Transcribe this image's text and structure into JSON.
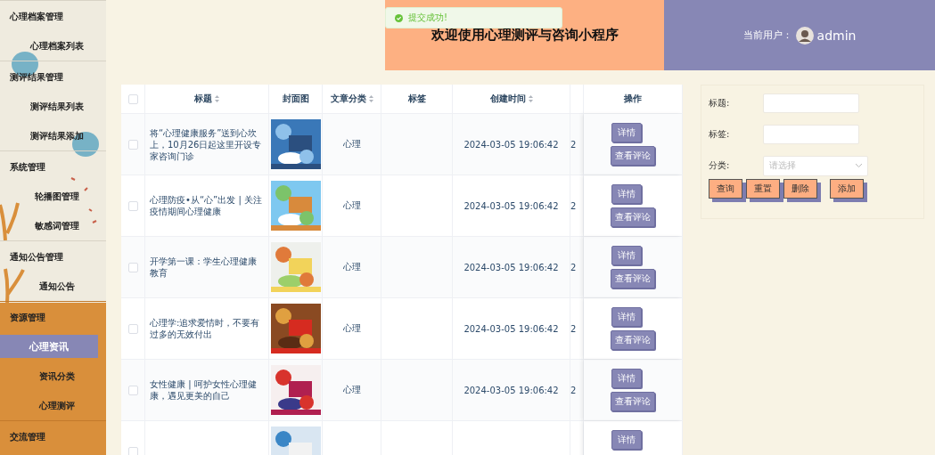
{
  "sidebar": {
    "groups": [
      {
        "label": "心理档案管理",
        "items": [
          {
            "label": "心理档案列表",
            "selected": false
          }
        ]
      },
      {
        "label": "测评结果管理",
        "items": [
          {
            "label": "测评结果列表",
            "selected": false
          },
          {
            "label": "测评结果添加",
            "selected": false
          }
        ]
      },
      {
        "label": "系统管理",
        "items": [
          {
            "label": "轮播图管理",
            "selected": false
          },
          {
            "label": "敏感词管理",
            "selected": false
          }
        ]
      },
      {
        "label": "通知公告管理",
        "items": [
          {
            "label": "通知公告",
            "selected": false
          }
        ]
      },
      {
        "label": "资源管理",
        "items": [
          {
            "label": "心理资讯",
            "selected": true
          },
          {
            "label": "资讯分类",
            "selected": false
          },
          {
            "label": "心理测评",
            "selected": false
          }
        ]
      },
      {
        "label": "交流管理"
      }
    ]
  },
  "header": {
    "title": "欢迎使用心理测评与咨询小程序",
    "user_label": "当前用户：",
    "username": "admin"
  },
  "toast": {
    "message": "提交成功!"
  },
  "table": {
    "all_checked": false,
    "columns": [
      {
        "label": "标题",
        "sortable": true
      },
      {
        "label": "封面图",
        "sortable": false
      },
      {
        "label": "文章分类",
        "sortable": true
      },
      {
        "label": "标签",
        "sortable": false
      },
      {
        "label": "创建时间",
        "sortable": true
      },
      {
        "label": "操作",
        "sortable": false
      }
    ],
    "rows": [
      {
        "checked": false,
        "title": "将“心理健康服务”送到心坎上，10月26日起这里开设专家咨询门诊",
        "cover": {
          "kind": "picture"
        },
        "category": "心理",
        "created": "2024-03-05 19:06:42",
        "column_7": "2",
        "actions": [
          "详情",
          "查看评论"
        ]
      },
      {
        "checked": false,
        "title": "心理防疫•从“心”出发 | 关注疫情期间心理健康",
        "cover": {
          "kind": "picture"
        },
        "category": "心理",
        "created": "2024-03-05 19:06:42",
        "column_7": "2",
        "actions": [
          "详情",
          "查看评论"
        ]
      },
      {
        "checked": false,
        "title": "开学第一课：学生心理健康教育",
        "cover": {
          "kind": "picture"
        },
        "category": "心理",
        "created": "2024-03-05 19:06:42",
        "column_7": "2",
        "actions": [
          "详情",
          "查看评论"
        ]
      },
      {
        "checked": false,
        "title": "心理学:追求爱情时，不要有过多的无效付出",
        "cover": {
          "kind": "picture"
        },
        "category": "心理",
        "created": "2024-03-05 19:06:42",
        "column_7": "2",
        "actions": [
          "详情",
          "查看评论"
        ]
      },
      {
        "checked": false,
        "title": "女性健康 | 呵护女性心理健康，遇见更美的自己",
        "cover": {
          "kind": "picture"
        },
        "category": "心理",
        "created": "2024-03-05 19:06:42",
        "column_7": "2",
        "actions": [
          "详情",
          "查看评论"
        ]
      },
      {
        "checked": false,
        "cover": {
          "kind": "picture"
        },
        "actions": [
          "详情"
        ]
      }
    ]
  },
  "search": {
    "fields": [
      {
        "label": "标题:",
        "kind": "text"
      },
      {
        "label": "标签:",
        "kind": "text"
      },
      {
        "label": "分类:",
        "kind": "select",
        "placeholder": "请选择"
      }
    ],
    "buttons": [
      "查询",
      "重置",
      "删除",
      "添加"
    ]
  }
}
